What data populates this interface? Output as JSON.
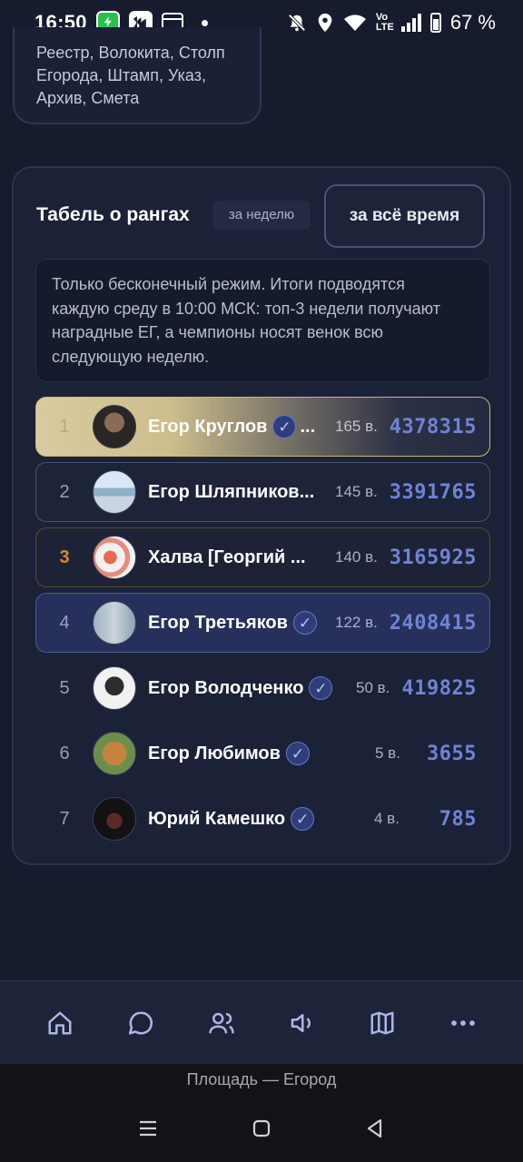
{
  "status_bar": {
    "time": "16:50",
    "battery_text": "67 %",
    "icons": [
      "shield-vpn-icon",
      "app-icon",
      "calendar-icon",
      "notification-dot",
      "mute-bell-icon",
      "location-icon",
      "wifi-icon",
      "volte-icon",
      "signal-icon",
      "battery-icon"
    ],
    "volte_label": "Vo LTE"
  },
  "top_card": {
    "text_lines": [
      "Реестр, Волокита, Столп",
      "Егорода, Штамп, Указ,",
      "Архив, Смета"
    ]
  },
  "board": {
    "title": "Табель о рангах",
    "tab_week": "за неделю",
    "tab_all_time": "за всё время",
    "info_lines": [
      "Только бесконечный режим. Итоги подводятся",
      "каждую среду в 10:00 МСК: топ-3 недели получают",
      "наградные ЕГ, а чемпионы носят венок всю",
      "следующую неделю."
    ],
    "rows": [
      {
        "rank": "1",
        "name": "Егор Круглов",
        "verified": true,
        "ellipsis": "...",
        "games": "165 в.",
        "score": "4378315"
      },
      {
        "rank": "2",
        "name": "Егор Шляпников...",
        "verified": false,
        "ellipsis": "",
        "games": "145 в.",
        "score": "3391765"
      },
      {
        "rank": "3",
        "name": "Халва [Георгий ...",
        "verified": false,
        "ellipsis": "",
        "games": "140 в.",
        "score": "3165925"
      },
      {
        "rank": "4",
        "name": "Егор Третьяков",
        "verified": true,
        "ellipsis": "",
        "games": "122 в.",
        "score": "2408415"
      },
      {
        "rank": "5",
        "name": "Егор Володченко",
        "verified": true,
        "ellipsis": "",
        "games": "50 в.",
        "score": "419825"
      },
      {
        "rank": "6",
        "name": "Егор Любимов",
        "verified": true,
        "ellipsis": "",
        "games": "5 в.",
        "score": "3655"
      },
      {
        "rank": "7",
        "name": "Юрий Камешко",
        "verified": true,
        "ellipsis": "",
        "games": "4 в.",
        "score": "785"
      }
    ],
    "check_glyph": "✓"
  },
  "bottom_nav": {
    "items": [
      "home-icon",
      "chat-icon",
      "people-icon",
      "sound-icon",
      "map-icon",
      "more-icon"
    ]
  },
  "caption": "Площадь — Егород",
  "system_nav": [
    "menu-icon",
    "home-square-icon",
    "back-icon"
  ],
  "colors": {
    "background": "#161b2e",
    "card": "#1b2136",
    "score_accent": "#6f83d6",
    "gold": "#cbb879",
    "bronze": "#d6892f",
    "highlight": "#26305a"
  }
}
